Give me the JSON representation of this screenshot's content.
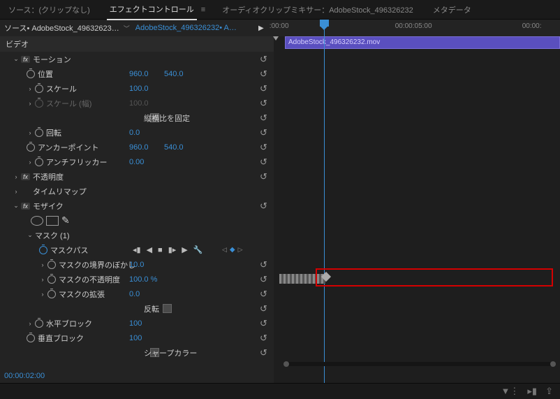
{
  "tabs": {
    "source": "ソース：(クリップなし)",
    "effectControls": "エフェクトコントロール",
    "audioMixer": "オーディオクリップミキサー：AdobeStock_496326232",
    "metadata": "メタデータ"
  },
  "subheader": {
    "source": "ソース• AdobeStock_49632623…",
    "sequence": "AdobeStock_496326232• A…"
  },
  "ruler": {
    "t0": ":00:00",
    "t1": "00:00:05:00",
    "t2": "00:00:"
  },
  "clip": {
    "name": "AdobeStock_496326232.mov"
  },
  "panel": {
    "videoHeader": "ビデオ",
    "motion": {
      "label": "モーション",
      "position": {
        "label": "位置",
        "x": "960.0",
        "y": "540.0"
      },
      "scale": {
        "label": "スケール",
        "value": "100.0"
      },
      "scaleW": {
        "label": "スケール (幅)",
        "value": "100.0"
      },
      "uniform": {
        "label": "縦横比を固定",
        "checked": true
      },
      "rotation": {
        "label": "回転",
        "value": "0.0"
      },
      "anchor": {
        "label": "アンカーポイント",
        "x": "960.0",
        "y": "540.0"
      },
      "antiflicker": {
        "label": "アンチフリッカー",
        "value": "0.00"
      }
    },
    "opacity": {
      "label": "不透明度"
    },
    "timeremap": {
      "label": "タイムリマップ"
    },
    "mosaic": {
      "label": "モザイク",
      "mask": {
        "label": "マスク (1)",
        "path": {
          "label": "マスクパス"
        },
        "feather": {
          "label": "マスクの境界のぼかし",
          "value": "10.0"
        },
        "opacity": {
          "label": "マスクの不透明度",
          "value": "100.0 %"
        },
        "expansion": {
          "label": "マスクの拡張",
          "value": "0.0"
        },
        "invert": {
          "label": "反転",
          "checked": false
        }
      },
      "hblocks": {
        "label": "水平ブロック",
        "value": "100"
      },
      "vblocks": {
        "label": "垂直ブロック",
        "value": "100"
      },
      "sharp": {
        "label": "シャープカラー",
        "checked": false
      }
    }
  },
  "timecode": "00:00:02:00"
}
